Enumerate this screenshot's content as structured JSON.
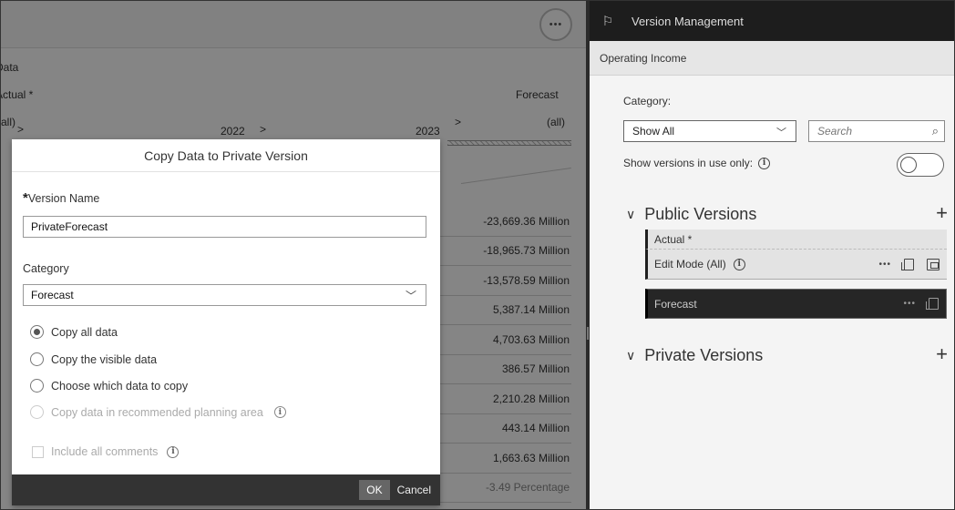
{
  "left_table": {
    "labels": {
      "data": "Data",
      "actual": "Actual *",
      "forecast": "Forecast",
      "all_left": "(all)",
      "all_right": "(all)",
      "year_2022": "2022",
      "year_2023": "2023"
    },
    "values": [
      "-23,669.36 Million",
      "-18,965.73 Million",
      "-13,578.59 Million",
      "5,387.14 Million",
      "4,703.63 Million",
      "386.57 Million",
      "2,210.28 Million",
      "443.14 Million",
      "1,663.63 Million",
      "-3.49 Percentage"
    ]
  },
  "dialog": {
    "title": "Copy Data to Private Version",
    "version_name_label": "Version Name",
    "version_name_value": "PrivateForecast",
    "category_label": "Category",
    "category_value": "Forecast",
    "options": [
      "Copy all data",
      "Copy the visible data",
      "Choose which data to copy",
      "Copy data in recommended planning area"
    ],
    "selected_option": "Copy all data",
    "include_comments": "Include all comments",
    "ok": "OK",
    "cancel": "Cancel"
  },
  "version_panel": {
    "title": "Version Management",
    "subtitle": "Operating Income",
    "category_label": "Category:",
    "category_value": "Show All",
    "search_placeholder": "Search",
    "in_use_label": "Show versions in use only:",
    "public_header": "Public Versions",
    "private_header": "Private Versions",
    "public_versions": [
      {
        "name": "Actual *"
      },
      {
        "name": "Edit Mode (All)"
      },
      {
        "name": "Forecast"
      }
    ]
  }
}
